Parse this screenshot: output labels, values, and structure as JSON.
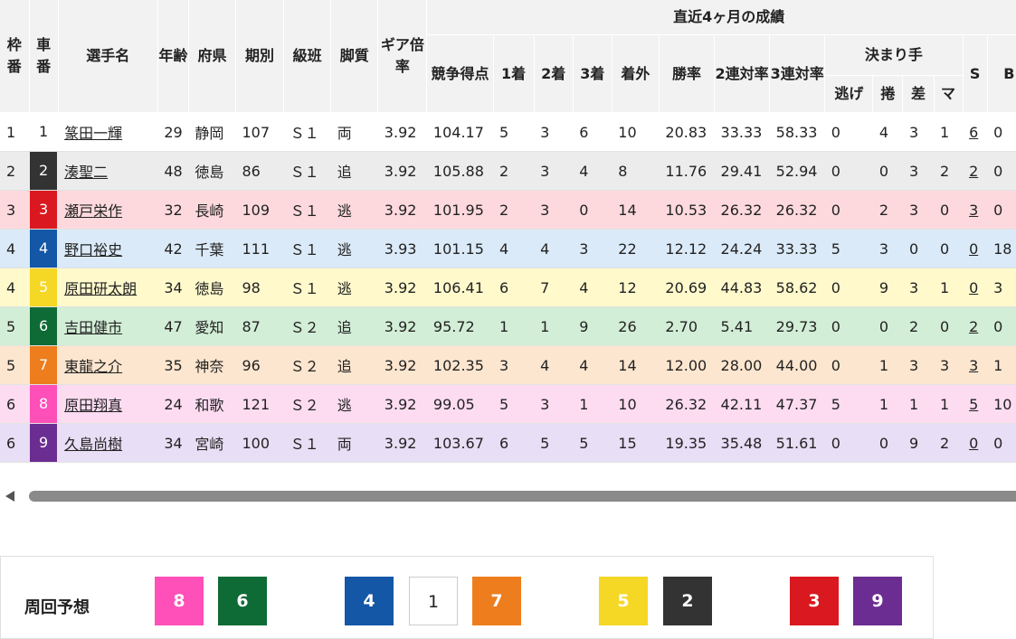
{
  "headers": {
    "waku": "枠番",
    "car": "車番",
    "name": "選手名",
    "age": "年齢",
    "pref": "府県",
    "term": "期別",
    "class": "級班",
    "style": "脚質",
    "gear": "ギア倍率",
    "recent": "直近4ヶ月の成績",
    "score": "競争得点",
    "first": "1着",
    "second": "2着",
    "third": "3着",
    "out": "着外",
    "win_rate": "勝率",
    "rate2": "2連対率",
    "rate3": "3連対率",
    "kimarite": "決まり手",
    "nige": "逃げ",
    "makuri": "捲",
    "sashi": "差",
    "ma": "マ",
    "s": "S",
    "b": "B"
  },
  "car_colors": {
    "1": {
      "bg": "#ffffff",
      "fg": "#222222"
    },
    "2": {
      "bg": "#333333",
      "fg": "#ffffff"
    },
    "3": {
      "bg": "#d9191f",
      "fg": "#ffffff"
    },
    "4": {
      "bg": "#1357a6",
      "fg": "#ffffff"
    },
    "5": {
      "bg": "#f5d726",
      "fg": "#ffffff"
    },
    "6": {
      "bg": "#0e6b36",
      "fg": "#ffffff"
    },
    "7": {
      "bg": "#ee7d1d",
      "fg": "#ffffff"
    },
    "8": {
      "bg": "#ff4fb8",
      "fg": "#ffffff"
    },
    "9": {
      "bg": "#6b2d91",
      "fg": "#ffffff"
    }
  },
  "rows": [
    {
      "waku": "1",
      "car": "1",
      "name": "篆田一輝",
      "age": "29",
      "pref": "静岡",
      "term": "107",
      "class": "Ｓ１",
      "style": "両",
      "gear": "3.92",
      "score": "104.17",
      "first": "5",
      "second": "3",
      "third": "6",
      "out": "10",
      "win_rate": "20.83",
      "rate2": "33.33",
      "rate3": "58.33",
      "nige": "0",
      "makuri": "4",
      "sashi": "3",
      "ma": "1",
      "s": "6",
      "b": "0",
      "row_bg": "#ffffff"
    },
    {
      "waku": "2",
      "car": "2",
      "name": "湊聖二",
      "age": "48",
      "pref": "徳島",
      "term": "86",
      "class": "Ｓ１",
      "style": "追",
      "gear": "3.92",
      "score": "105.88",
      "first": "2",
      "second": "3",
      "third": "4",
      "out": "8",
      "win_rate": "11.76",
      "rate2": "29.41",
      "rate3": "52.94",
      "nige": "0",
      "makuri": "0",
      "sashi": "3",
      "ma": "2",
      "s": "2",
      "b": "0",
      "row_bg": "#ececec"
    },
    {
      "waku": "3",
      "car": "3",
      "name": "瀬戸栄作",
      "age": "32",
      "pref": "長崎",
      "term": "109",
      "class": "Ｓ１",
      "style": "逃",
      "gear": "3.92",
      "score": "101.95",
      "first": "2",
      "second": "3",
      "third": "0",
      "out": "14",
      "win_rate": "10.53",
      "rate2": "26.32",
      "rate3": "26.32",
      "nige": "0",
      "makuri": "2",
      "sashi": "3",
      "ma": "0",
      "s": "3",
      "b": "0",
      "row_bg": "#fdd9dd"
    },
    {
      "waku": "4",
      "car": "4",
      "name": "野口裕史",
      "age": "42",
      "pref": "千葉",
      "term": "111",
      "class": "Ｓ１",
      "style": "逃",
      "gear": "3.93",
      "score": "101.15",
      "first": "4",
      "second": "4",
      "third": "3",
      "out": "22",
      "win_rate": "12.12",
      "rate2": "24.24",
      "rate3": "33.33",
      "nige": "5",
      "makuri": "3",
      "sashi": "0",
      "ma": "0",
      "s": "0",
      "b": "18",
      "row_bg": "#dbeaf8"
    },
    {
      "waku": "4",
      "car": "5",
      "name": "原田研太朗",
      "age": "34",
      "pref": "徳島",
      "term": "98",
      "class": "Ｓ１",
      "style": "逃",
      "gear": "3.92",
      "score": "106.41",
      "first": "6",
      "second": "7",
      "third": "4",
      "out": "12",
      "win_rate": "20.69",
      "rate2": "44.83",
      "rate3": "58.62",
      "nige": "0",
      "makuri": "9",
      "sashi": "3",
      "ma": "1",
      "s": "0",
      "b": "3",
      "row_bg": "#fff9cc"
    },
    {
      "waku": "5",
      "car": "6",
      "name": "吉田健市",
      "age": "47",
      "pref": "愛知",
      "term": "87",
      "class": "Ｓ２",
      "style": "追",
      "gear": "3.92",
      "score": "95.72",
      "first": "1",
      "second": "1",
      "third": "9",
      "out": "26",
      "win_rate": "2.70",
      "rate2": "5.41",
      "rate3": "29.73",
      "nige": "0",
      "makuri": "0",
      "sashi": "2",
      "ma": "0",
      "s": "2",
      "b": "0",
      "row_bg": "#d2eed6"
    },
    {
      "waku": "5",
      "car": "7",
      "name": "東龍之介",
      "age": "35",
      "pref": "神奈",
      "term": "96",
      "class": "Ｓ２",
      "style": "追",
      "gear": "3.92",
      "score": "102.35",
      "first": "3",
      "second": "4",
      "third": "4",
      "out": "14",
      "win_rate": "12.00",
      "rate2": "28.00",
      "rate3": "44.00",
      "nige": "0",
      "makuri": "1",
      "sashi": "3",
      "ma": "3",
      "s": "3",
      "b": "1",
      "row_bg": "#fde6cf"
    },
    {
      "waku": "6",
      "car": "8",
      "name": "原田翔真",
      "age": "24",
      "pref": "和歌",
      "term": "121",
      "class": "Ｓ２",
      "style": "逃",
      "gear": "3.92",
      "score": "99.05",
      "first": "5",
      "second": "3",
      "third": "1",
      "out": "10",
      "win_rate": "26.32",
      "rate2": "42.11",
      "rate3": "47.37",
      "nige": "5",
      "makuri": "1",
      "sashi": "1",
      "ma": "1",
      "s": "5",
      "b": "10",
      "row_bg": "#fddcf2"
    },
    {
      "waku": "6",
      "car": "9",
      "name": "久島尚樹",
      "age": "34",
      "pref": "宮崎",
      "term": "100",
      "class": "Ｓ１",
      "style": "両",
      "gear": "3.92",
      "score": "103.67",
      "first": "6",
      "second": "5",
      "third": "5",
      "out": "15",
      "win_rate": "19.35",
      "rate2": "35.48",
      "rate3": "51.61",
      "nige": "0",
      "makuri": "0",
      "sashi": "9",
      "ma": "2",
      "s": "0",
      "b": "0",
      "row_bg": "#e8def5"
    }
  ],
  "prediction": {
    "label": "周回予想",
    "order": [
      "8",
      "6",
      "4",
      "1",
      "7",
      "5",
      "2",
      "3",
      "9"
    ]
  }
}
